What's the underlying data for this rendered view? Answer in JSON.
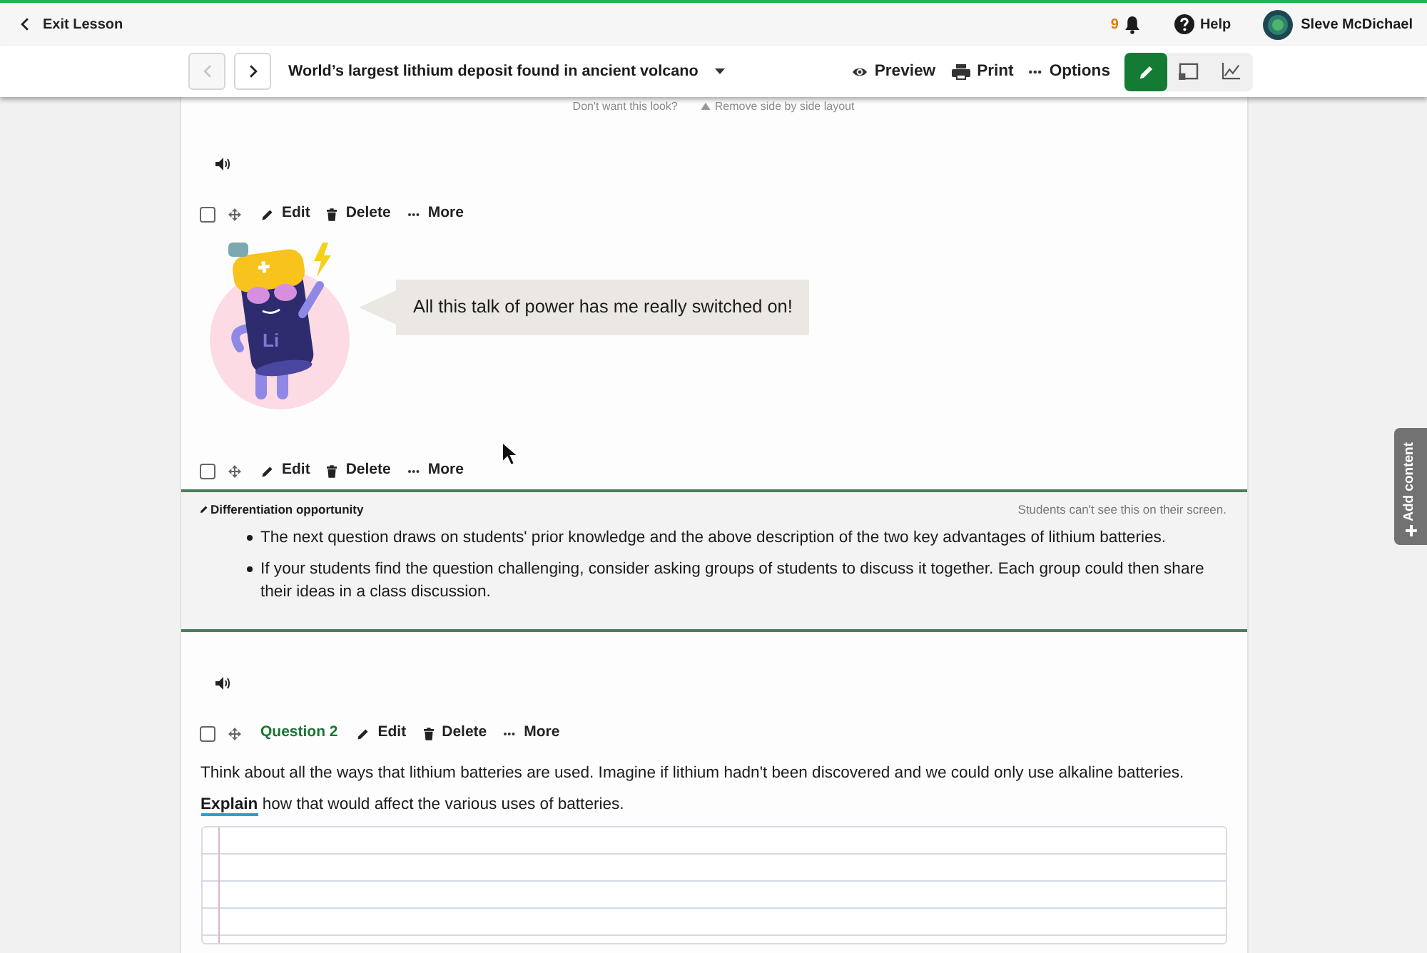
{
  "top_bar": {
    "exit_label": "Exit Lesson",
    "notification_count": "9",
    "help_label": "Help",
    "user_name": "Sleve McDichael"
  },
  "lesson_bar": {
    "nav_buttons": [
      {
        "kind": "prev",
        "disabled": true
      },
      {
        "kind": "next",
        "disabled": false
      }
    ],
    "title": "World’s largest lithium deposit found in ancient volcano",
    "actions": [
      {
        "kind": "preview",
        "label": "Preview"
      },
      {
        "kind": "print",
        "label": "Print"
      },
      {
        "kind": "options",
        "label": "Options"
      }
    ],
    "modes": [
      {
        "kind": "edit",
        "selected": true
      },
      {
        "kind": "present",
        "selected": false
      },
      {
        "kind": "results",
        "selected": false
      }
    ]
  },
  "layout_notice": {
    "prompt": "Don't want this look?",
    "action": "Remove side by side layout"
  },
  "content": [
    {
      "kind": "speech",
      "audio": true,
      "toolbar": {
        "checked": false,
        "actions": [
          {
            "kind": "edit",
            "label": "Edit"
          },
          {
            "kind": "delete",
            "label": "Delete"
          },
          {
            "kind": "more",
            "label": "More"
          }
        ]
      },
      "mascot_label": "Li",
      "text": "All this talk of power has me really switched on!"
    },
    {
      "kind": "note",
      "audio": false,
      "toolbar": {
        "checked": false,
        "actions": [
          {
            "kind": "edit",
            "label": "Edit"
          },
          {
            "kind": "delete",
            "label": "Delete"
          },
          {
            "kind": "more",
            "label": "More"
          }
        ]
      },
      "title": "Differentiation opportunity",
      "visibility": "Students can't see this on their screen.",
      "bullets": [
        "The next question draws on students' prior knowledge and the above description of the two key advantages of lithium batteries.",
        "If your students find the question challenging, consider asking groups of students to discuss it together. Each group could then share their ideas in a class discussion."
      ]
    },
    {
      "kind": "question",
      "audio": true,
      "toolbar": {
        "checked": false,
        "label": "Question 2",
        "actions": [
          {
            "kind": "edit",
            "label": "Edit"
          },
          {
            "kind": "delete",
            "label": "Delete"
          },
          {
            "kind": "more",
            "label": "More"
          }
        ]
      },
      "paragraphs": [
        "Think about all the ways that lithium batteries are used. Imagine if lithium hadn't been discovered and we could only use alkaline batteries.",
        "**Explain** how that would affect the various uses of batteries."
      ]
    }
  ],
  "side_tab": {
    "label": "Add content"
  }
}
